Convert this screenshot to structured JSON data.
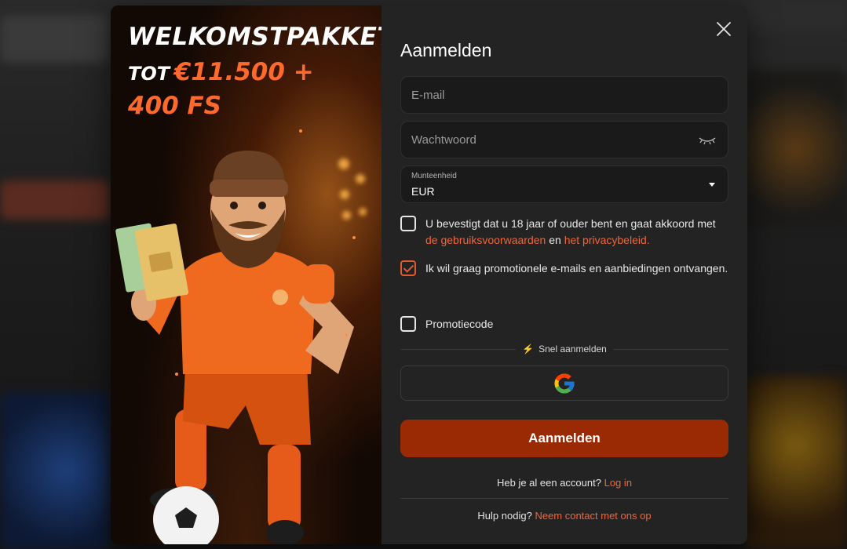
{
  "promo": {
    "title": "WELKOMSTPAKKET",
    "prefix": "TOT",
    "amount": "€11.500 +",
    "spins": "400 FS"
  },
  "form": {
    "title": "Aanmelden",
    "email_placeholder": "E-mail",
    "password_placeholder": "Wachtwoord",
    "currency_label": "Munteenheid",
    "currency_value": "EUR",
    "terms": {
      "text_before": "U bevestigt dat u 18 jaar of ouder bent en gaat akkoord met ",
      "link_terms": "de gebruiksvoorwaarden",
      "text_mid": " en ",
      "link_privacy": "het privacybeleid.",
      "checked": false
    },
    "marketing": {
      "text": "Ik wil graag promotionele e-mails en aanbiedingen ontvangen.",
      "checked": true
    },
    "promo_code": {
      "label": "Promotiecode",
      "checked": false
    },
    "quick_signup_label": "Snel aanmelden",
    "submit_label": "Aanmelden",
    "have_account": "Heb je al een account?",
    "login_link": "Log in",
    "help_text": "Hulp nodig?",
    "contact_link": "Neem contact met ons op"
  },
  "colors": {
    "accent": "#f0653a",
    "submit_bg": "#9a2a04",
    "panel_bg": "#232323"
  },
  "icons": {
    "close": "close-icon",
    "eye": "eye-closed-icon",
    "caret": "caret-down-icon",
    "bolt": "lightning-icon",
    "google": "google-icon"
  }
}
